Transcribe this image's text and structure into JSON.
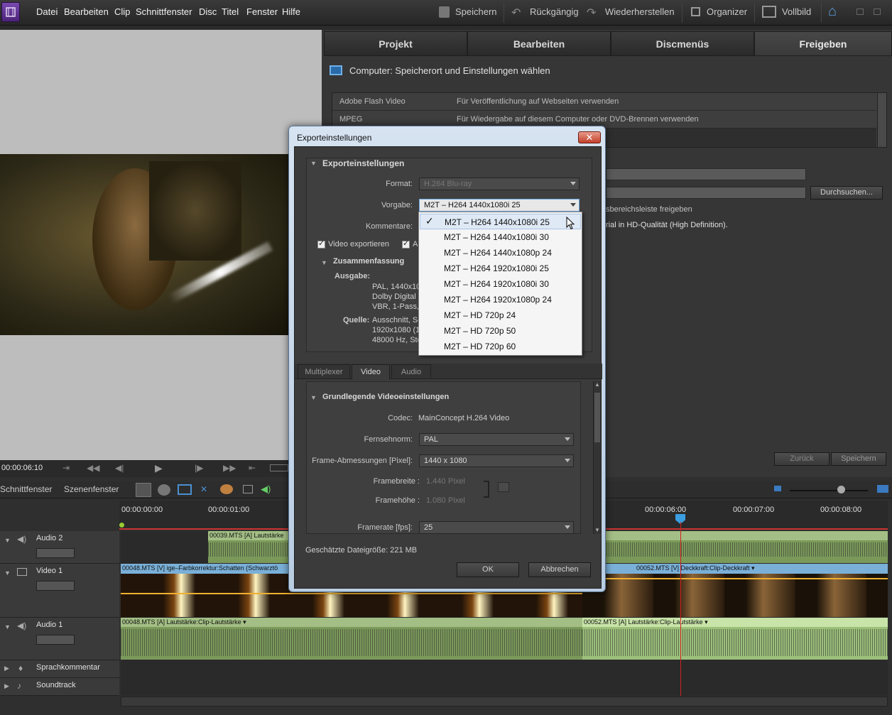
{
  "menu": [
    "Datei",
    "Bearbeiten",
    "Clip",
    "Schnittfenster",
    "Disc",
    "Titel",
    "Fenster",
    "Hilfe"
  ],
  "toolbar": {
    "save": "Speichern",
    "undo": "Rückgängig",
    "redo": "Wiederherstellen",
    "organizer": "Organizer",
    "fullscreen": "Vollbild"
  },
  "tabs": [
    "Projekt",
    "Bearbeiten",
    "Discmenüs",
    "Freigeben"
  ],
  "share": {
    "heading": "Computer: Speicherort und Einstellungen wählen",
    "rows": [
      {
        "name": "Adobe Flash Video",
        "desc": "Für Veröffentlichung auf Webseiten verwenden"
      },
      {
        "name": "MPEG",
        "desc": "Für Wiedergabe auf diesem Computer oder DVD-Brennen verwenden"
      }
    ],
    "browse": "Durchsuchen...",
    "partial1": "sbereichsleiste freigeben",
    "partial2": "rial in HD-Qualität (High Definition).",
    "back": "Zurück",
    "save": "Speichern"
  },
  "monitor": {
    "timecode": "00:00:06:10"
  },
  "timeline": {
    "tabs": [
      "Schnittfenster",
      "Szenenfenster"
    ],
    "ruler": [
      "00:00:00:00",
      "00:00:01:00",
      "00:00:06:00",
      "00:00:07:00",
      "00:00:08:00"
    ],
    "tracks": [
      "Audio 2",
      "Video 1",
      "Audio 1",
      "Sprachkommentar",
      "Soundtrack"
    ],
    "clips": {
      "a2": "00039.MTS [A]  Lautstärke",
      "v1a": "00048.MTS [V]  ige–Farbkorrektur:Schatten (Schwarztö",
      "v1b": "00052.MTS [V]  Deckkraft:Clip-Deckkraft ▾",
      "a1a": "00048.MTS [A]  Lautstärke:Clip-Lautstärke ▾",
      "a1b": "00052.MTS [A]  Lautstärke:Clip-Lautstärke ▾"
    }
  },
  "dialog": {
    "title": "Exporteinstellungen",
    "section1": "Exporteinstellungen",
    "format_label": "Format:",
    "format_value": "H.264 Blu-ray",
    "preset_label": "Vorgabe:",
    "preset_value": "M2T – H264 1440x1080i 25",
    "comments_label": "Kommentare:",
    "export_video": "Video exportieren",
    "export_audio_partial": "Au",
    "summary": "Zusammenfassung",
    "output_label": "Ausgabe:",
    "output_lines": [
      "PAL, 1440x10",
      "Dolby Digital",
      "VBR, 1-Pass,"
    ],
    "source_label": "Quelle:",
    "source_lines": [
      "Ausschnitt, Se",
      "1920x1080 (1",
      "48000 Hz, Ste"
    ],
    "subtabs": [
      "Multiplexer",
      "Video",
      "Audio"
    ],
    "section2": "Grundlegende Videoeinstellungen",
    "codec_label": "Codec:",
    "codec_value": "MainConcept H.264 Video",
    "tvnorm_label": "Fernsehnorm:",
    "tvnorm_value": "PAL",
    "framesize_label": "Frame-Abmessungen [Pixel]:",
    "framesize_value": "1440 x 1080",
    "width_label": "Framebreite :",
    "width_value": "1.440",
    "height_label": "Framehöhe :",
    "height_value": "1.080",
    "pixel_unit": "Pixel",
    "framerate_label": "Framerate [fps]:",
    "framerate_value": "25",
    "filesize": "Geschätzte Dateigröße:  221 MB",
    "ok": "OK",
    "cancel": "Abbrechen"
  },
  "dropdown": [
    "M2T – H264 1440x1080i 25",
    "M2T – H264 1440x1080i 30",
    "M2T – H264 1440x1080p 24",
    "M2T – H264 1920x1080i 25",
    "M2T – H264 1920x1080i 30",
    "M2T – H264 1920x1080p 24",
    "M2T – HD 720p 24",
    "M2T – HD 720p 50",
    "M2T – HD 720p 60"
  ]
}
